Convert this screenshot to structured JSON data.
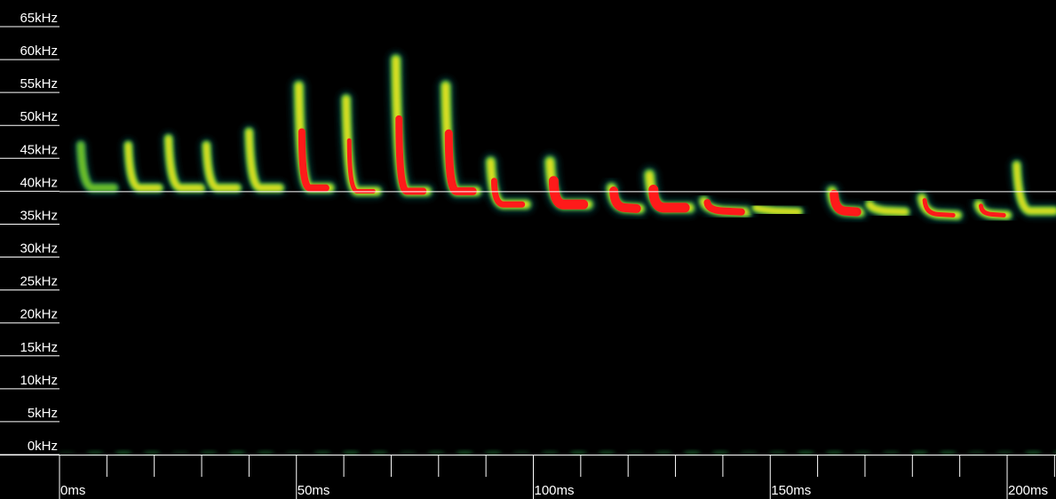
{
  "chart_data": {
    "type": "heatmap",
    "title": "",
    "xlabel": "",
    "ylabel": "",
    "x_unit": "ms",
    "y_unit": "kHz",
    "xlim": [
      0,
      210
    ],
    "ylim": [
      0,
      65
    ],
    "x_ticks": [
      {
        "value": 0,
        "label": "0ms"
      },
      {
        "value": 50,
        "label": "50ms"
      },
      {
        "value": 100,
        "label": "100ms"
      },
      {
        "value": 150,
        "label": "150ms"
      },
      {
        "value": 200,
        "label": "200ms"
      }
    ],
    "x_minor_step": 10,
    "y_ticks": [
      {
        "value": 65,
        "label": "65kHz"
      },
      {
        "value": 60,
        "label": "60kHz"
      },
      {
        "value": 55,
        "label": "55kHz"
      },
      {
        "value": 50,
        "label": "50kHz"
      },
      {
        "value": 45,
        "label": "45kHz"
      },
      {
        "value": 40,
        "label": "40kHz"
      },
      {
        "value": 35,
        "label": "35kHz"
      },
      {
        "value": 30,
        "label": "30kHz"
      },
      {
        "value": 25,
        "label": "25kHz"
      },
      {
        "value": 20,
        "label": "20kHz"
      },
      {
        "value": 15,
        "label": "15kHz"
      },
      {
        "value": 10,
        "label": "10kHz"
      },
      {
        "value": 5,
        "label": "5kHz"
      },
      {
        "value": 0,
        "label": "0kHz"
      }
    ],
    "reference_line_khz": 40,
    "colormap": [
      "#0a3a3a",
      "#1f7a3a",
      "#6fbf2a",
      "#e0e020",
      "#ff1a1a"
    ],
    "calls": [
      {
        "start_ms": 4.5,
        "end_ms": 11.5,
        "f_start_khz": 47,
        "f_end_khz": 40.5,
        "intensity": 0.35
      },
      {
        "start_ms": 14.5,
        "end_ms": 21,
        "f_start_khz": 47,
        "f_end_khz": 40.5,
        "intensity": 0.45
      },
      {
        "start_ms": 23,
        "end_ms": 30,
        "f_start_khz": 48,
        "f_end_khz": 40.5,
        "intensity": 0.5
      },
      {
        "start_ms": 31,
        "end_ms": 37.5,
        "f_start_khz": 47,
        "f_end_khz": 40.5,
        "intensity": 0.5
      },
      {
        "start_ms": 40,
        "end_ms": 46.5,
        "f_start_khz": 49,
        "f_end_khz": 40.5,
        "intensity": 0.55
      },
      {
        "start_ms": 50.5,
        "end_ms": 57,
        "f_start_khz": 56,
        "f_end_khz": 40.5,
        "intensity": 0.85
      },
      {
        "start_ms": 60.5,
        "end_ms": 67,
        "f_start_khz": 54,
        "f_end_khz": 40,
        "intensity": 0.7
      },
      {
        "start_ms": 71,
        "end_ms": 77.5,
        "f_start_khz": 60,
        "f_end_khz": 40,
        "intensity": 0.85
      },
      {
        "start_ms": 81.5,
        "end_ms": 88,
        "f_start_khz": 56,
        "f_end_khz": 40,
        "intensity": 0.9
      },
      {
        "start_ms": 91,
        "end_ms": 98.5,
        "f_start_khz": 44.5,
        "f_end_khz": 38,
        "intensity": 0.8
      },
      {
        "start_ms": 103.5,
        "end_ms": 111.5,
        "f_start_khz": 44.5,
        "f_end_khz": 38,
        "intensity": 1.0
      },
      {
        "start_ms": 116.5,
        "end_ms": 122.5,
        "f_start_khz": 40.5,
        "f_end_khz": 37.5,
        "intensity": 0.95
      },
      {
        "start_ms": 124.5,
        "end_ms": 133,
        "f_start_khz": 42.5,
        "f_end_khz": 37.5,
        "intensity": 1.0
      },
      {
        "start_ms": 136,
        "end_ms": 145,
        "f_start_khz": 38.5,
        "f_end_khz": 37,
        "intensity": 0.85
      },
      {
        "start_ms": 147,
        "end_ms": 156,
        "f_start_khz": 37.5,
        "f_end_khz": 37,
        "intensity": 0.5
      },
      {
        "start_ms": 163,
        "end_ms": 169,
        "f_start_khz": 40,
        "f_end_khz": 37,
        "intensity": 0.95
      },
      {
        "start_ms": 171,
        "end_ms": 178.5,
        "f_start_khz": 38,
        "f_end_khz": 37,
        "intensity": 0.6
      },
      {
        "start_ms": 182,
        "end_ms": 189.5,
        "f_start_khz": 39,
        "f_end_khz": 36.5,
        "intensity": 0.7
      },
      {
        "start_ms": 194,
        "end_ms": 200,
        "f_start_khz": 38,
        "f_end_khz": 36.5,
        "intensity": 0.7
      },
      {
        "start_ms": 202,
        "end_ms": 210,
        "f_start_khz": 44,
        "f_end_khz": 37,
        "intensity": 0.5
      }
    ],
    "noise_band_khz": 0,
    "grid": false,
    "legend": "none"
  }
}
